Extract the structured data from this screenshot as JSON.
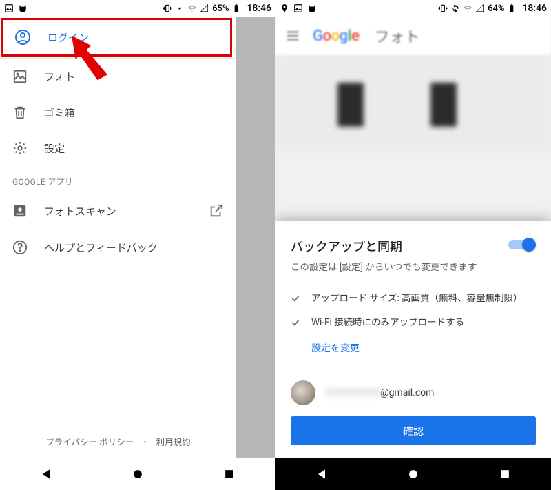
{
  "left": {
    "status": {
      "battery": "65%",
      "time": "18:46"
    },
    "login": {
      "label": "ログイン"
    },
    "menu": {
      "photos": "フォト",
      "trash": "ゴミ箱",
      "settings": "設定"
    },
    "section_title": "GOOGLE アプリ",
    "photoscan": "フォトスキャン",
    "help": "ヘルプとフィードバック",
    "footer": {
      "privacy": "プライバシー ポリシー",
      "dot": "・",
      "terms": "利用規約"
    }
  },
  "right": {
    "status": {
      "battery": "64%",
      "time": "18:46"
    },
    "header": {
      "photo_label": "フォト"
    },
    "sheet": {
      "title": "バックアップと同期",
      "subtitle": "この設定は [設定] からいつでも変更できます",
      "checks": [
        "アップロード サイズ: 高画質（無料、容量無制限）",
        "Wi-Fi 接続時にのみアップロードする"
      ],
      "change_link": "設定を変更",
      "email_suffix": "@gmail.com",
      "confirm": "確認",
      "toggle_on": true
    }
  }
}
